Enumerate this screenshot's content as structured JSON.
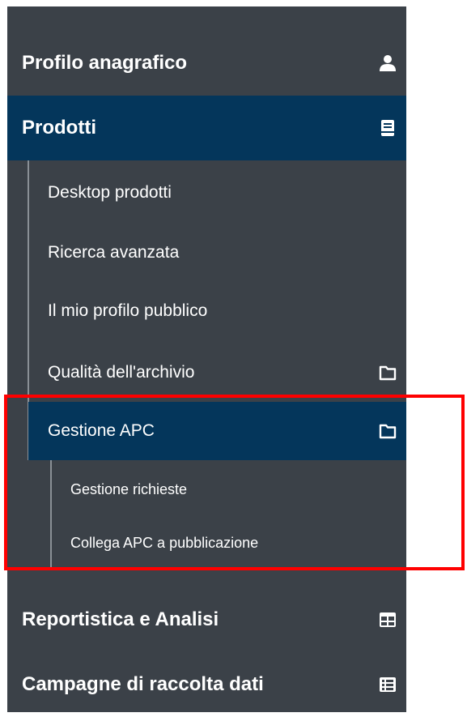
{
  "menu": {
    "profilo": {
      "label": "Profilo anagrafico",
      "icon": "user-icon"
    },
    "prodotti": {
      "label": "Prodotti",
      "icon": "book-icon",
      "children": [
        {
          "label": "Desktop prodotti"
        },
        {
          "label": "Ricerca avanzata"
        },
        {
          "label": "Il mio profilo pubblico"
        },
        {
          "label": "Qualità dell'archivio",
          "icon": "folder-icon"
        },
        {
          "label": "Gestione APC",
          "icon": "folder-icon",
          "children": [
            {
              "label": "Gestione richieste"
            },
            {
              "label": "Collega APC a pubblicazione"
            }
          ]
        }
      ]
    },
    "reportistica": {
      "label": "Reportistica e Analisi",
      "icon": "table-icon"
    },
    "campagne": {
      "label": "Campagne di raccolta dati",
      "icon": "list-icon"
    }
  },
  "colors": {
    "sidebar_bg": "#3b4148",
    "active_bg": "#04365b",
    "highlight_border": "#ff0000"
  }
}
